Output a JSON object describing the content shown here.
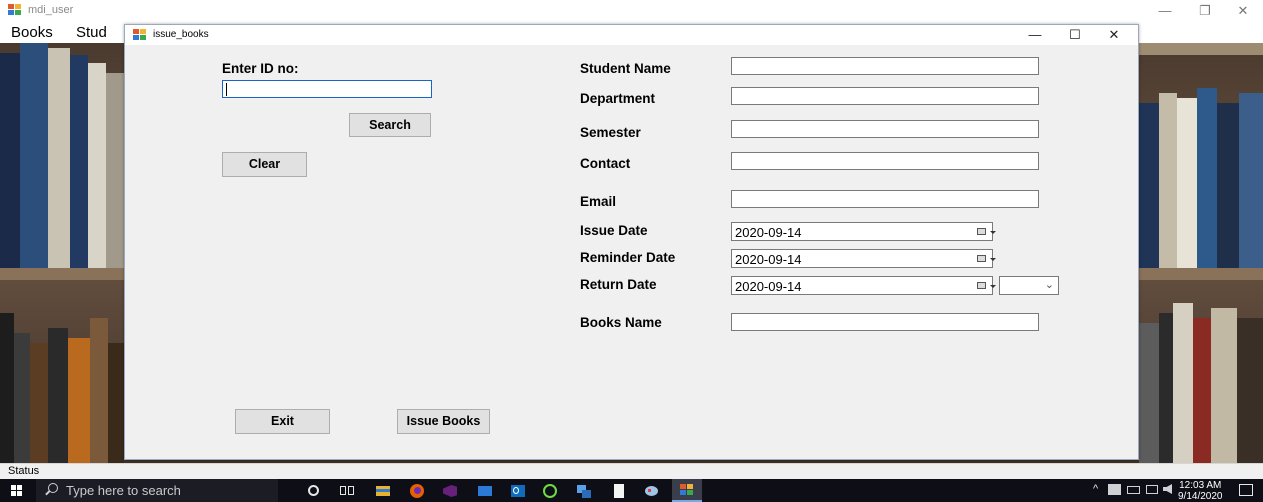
{
  "parent_window": {
    "title": "mdi_user",
    "controls": {
      "minimize": "—",
      "restore": "❐",
      "close": "✕"
    }
  },
  "menu": {
    "books": "Books",
    "students": "Stud"
  },
  "status_bar": {
    "text": "Status"
  },
  "child_window": {
    "title": "issue_books",
    "controls": {
      "minimize": "—",
      "maximize": "☐",
      "close": "✕"
    }
  },
  "form": {
    "enter_id_label": "Enter ID no:",
    "id_value": "",
    "search_button": "Search",
    "clear_button": "Clear",
    "exit_button": "Exit",
    "issue_button": "Issue Books",
    "fields": {
      "student_name": {
        "label": "Student Name",
        "value": ""
      },
      "department": {
        "label": "Department",
        "value": ""
      },
      "semester": {
        "label": "Semester",
        "value": ""
      },
      "contact": {
        "label": "Contact",
        "value": ""
      },
      "email": {
        "label": "Email",
        "value": ""
      },
      "issue_date": {
        "label": "Issue Date",
        "value": "2020-09-14"
      },
      "reminder_date": {
        "label": "Reminder Date",
        "value": "2020-09-14"
      },
      "return_date": {
        "label": "Return Date",
        "value": "2020-09-14"
      },
      "return_combo": {
        "value": ""
      },
      "books_name": {
        "label": "Books Name",
        "value": ""
      }
    }
  },
  "taskbar": {
    "search_placeholder": "Type here to search",
    "pinned": [
      "cortana-icon",
      "task-view-icon",
      "file-explorer-icon",
      "firefox-icon",
      "visual-studio-icon",
      "mail-icon",
      "outlook-icon",
      "upwork-icon",
      "network-app-icon",
      "notepad-icon",
      "paint-icon",
      "app-window-icon"
    ],
    "tray_chevron": "^",
    "clock_time": "12:03 AM",
    "clock_date": "9/14/2020"
  },
  "colors": {
    "accent_blue": "#1a64c8",
    "form_bg": "#f0f0f0",
    "taskbar_bg": "#0e0f16"
  }
}
